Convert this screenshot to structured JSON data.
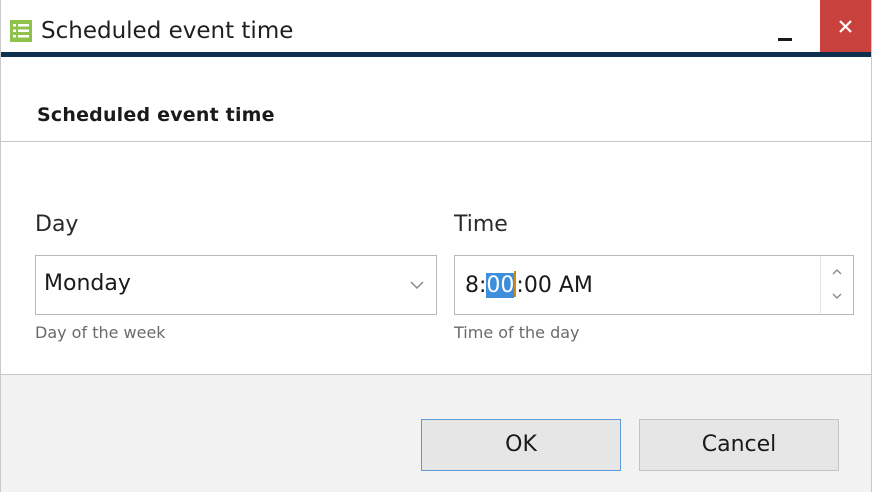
{
  "window": {
    "title": "Scheduled event time",
    "app_icon": "app-list-icon",
    "minimize_icon": "minimize-icon",
    "close_icon": "close-icon",
    "colors": {
      "accent_line": "#0f2f4f",
      "close_button": "#c9413c",
      "selection": "#3d8edb"
    }
  },
  "header": {
    "title": "Scheduled event time"
  },
  "day": {
    "label": "Day",
    "selected": "Monday",
    "hint": "Day of the week",
    "dropdown_icon": "chevron-down-icon"
  },
  "time": {
    "label": "Time",
    "value_hour": "8",
    "value_sep1": ":",
    "value_minutes": "00",
    "value_rest": ":00 AM",
    "hint": "Time of the day",
    "spin_up_icon": "chevron-up-icon",
    "spin_down_icon": "chevron-down-icon"
  },
  "buttons": {
    "ok": "OK",
    "cancel": "Cancel"
  }
}
